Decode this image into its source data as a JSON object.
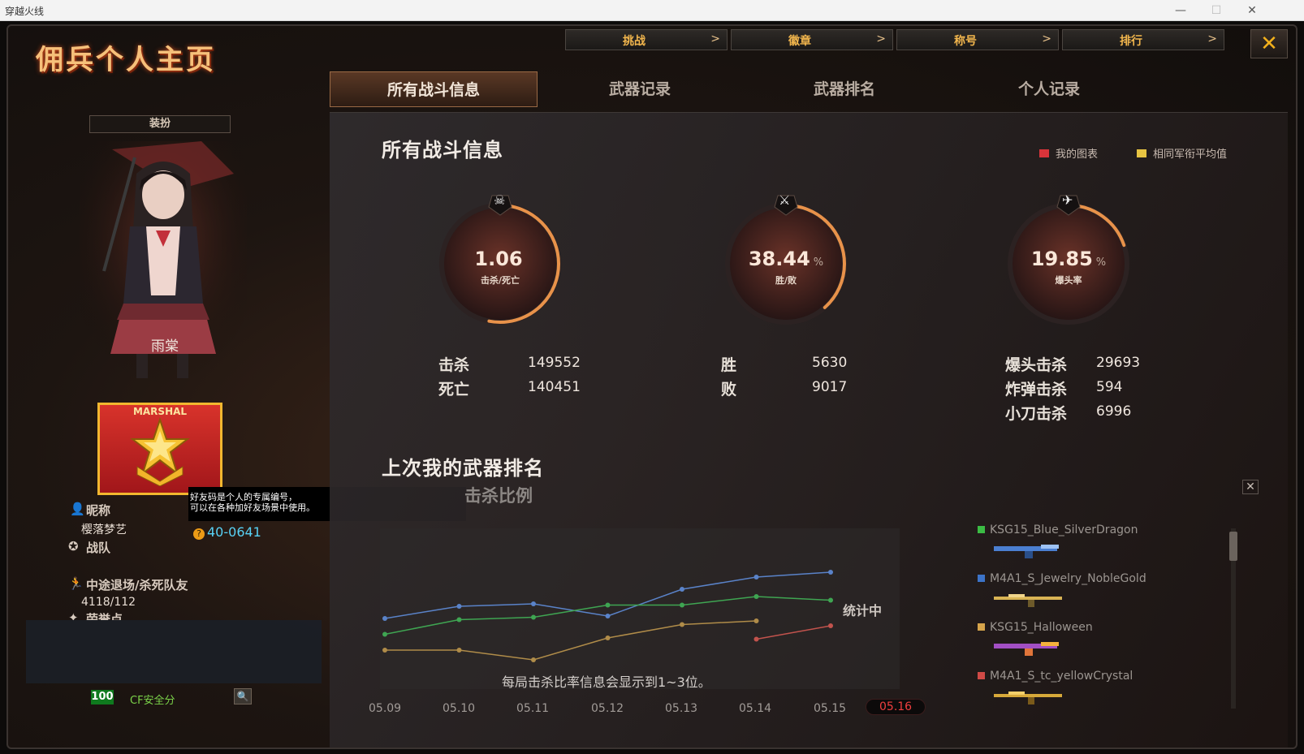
{
  "window": {
    "title": "穿越火线",
    "min": "—",
    "max": "☐",
    "close": "✕"
  },
  "page_title": "佣兵个人主页",
  "top_nav": [
    {
      "label": "挑战",
      "chev": ">"
    },
    {
      "label": "徽章",
      "chev": ">"
    },
    {
      "label": "称号",
      "chev": ">"
    },
    {
      "label": "排行",
      "chev": ">"
    }
  ],
  "close_icon": "✕",
  "sub_tabs": [
    "所有战斗信息",
    "武器记录",
    "武器排名",
    "个人记录"
  ],
  "left": {
    "outfit_button": "装扮",
    "character_name": "雨棠",
    "rank_text": "MARSHAL",
    "tooltip_line1": "好友码是个人的专属编号，",
    "tooltip_line2": "可以在各种加好友场景中使用。",
    "nickname_label": "昵称",
    "nickname_value": "樱落梦艺",
    "friend_code_icon": "?",
    "friend_code": "40-0641",
    "team_label": "战队",
    "quit_label": "中途退场/杀死队友",
    "quit_value": "4118/112",
    "honor_label": "荣誉点",
    "safety_score": "100",
    "safety_label": "CF安全分",
    "search_icon": "🔍"
  },
  "main": {
    "section_title": "所有战斗信息",
    "legend_mine": "我的图表",
    "legend_avg": "相同军衔平均值",
    "legend_colors": {
      "mine": "#d9343a",
      "avg": "#e7c442"
    },
    "gauges": [
      {
        "value": "1.06",
        "pct": "",
        "label": "击杀/死亡",
        "icon": "skull-icon",
        "fraction": 0.53
      },
      {
        "value": "38.44",
        "pct": "%",
        "label": "胜/败",
        "icon": "crossed-swords-icon",
        "fraction": 0.3844
      },
      {
        "value": "19.85",
        "pct": "%",
        "label": "爆头率",
        "icon": "rifle-icon",
        "fraction": 0.1985
      }
    ],
    "stats_a": [
      {
        "label": "击杀",
        "value": "149552"
      },
      {
        "label": "死亡",
        "value": "140451"
      }
    ],
    "stats_b": [
      {
        "label": "胜",
        "value": "5630"
      },
      {
        "label": "败",
        "value": "9017"
      }
    ],
    "stats_c": [
      {
        "label": "爆头击杀",
        "value": "29693"
      },
      {
        "label": "炸弹击杀",
        "value": "594"
      },
      {
        "label": "小刀击杀",
        "value": "6996"
      }
    ],
    "rank_title": "上次我的武器排名",
    "chart_subtitle": "击杀比例",
    "counting": "统计中",
    "chart_note": "每局击杀比率信息会显示到1~3位。",
    "panel_close": "✕"
  },
  "chart_data": {
    "type": "line",
    "title": "击杀比例",
    "x": [
      "05.09",
      "05.10",
      "05.11",
      "05.12",
      "05.13",
      "05.14",
      "05.15",
      "05.16"
    ],
    "active_x": "05.16",
    "ylim": [
      0,
      1
    ],
    "series": [
      {
        "color": "#5a83c9",
        "values": [
          0.38,
          0.48,
          0.5,
          0.4,
          0.62,
          0.72,
          0.76,
          null
        ]
      },
      {
        "color": "#3fa552",
        "values": [
          0.25,
          0.37,
          0.39,
          0.49,
          0.49,
          0.56,
          0.53,
          null
        ]
      },
      {
        "color": "#b08c49",
        "values": [
          0.12,
          0.12,
          0.04,
          0.22,
          0.33,
          0.36,
          null,
          null
        ]
      },
      {
        "color": "#c2534d",
        "values": [
          null,
          null,
          null,
          null,
          null,
          0.21,
          0.32,
          null
        ]
      }
    ]
  },
  "weapons": [
    {
      "name": "KSG15_Blue_SilverDragon",
      "color": "#3bbc44"
    },
    {
      "name": "M4A1_S_Jewelry_NobleGold",
      "color": "#3c73c8"
    },
    {
      "name": "KSG15_Halloween",
      "color": "#d6a44b"
    },
    {
      "name": "M4A1_S_tc_yellowCrystal",
      "color": "#d04a46"
    }
  ]
}
